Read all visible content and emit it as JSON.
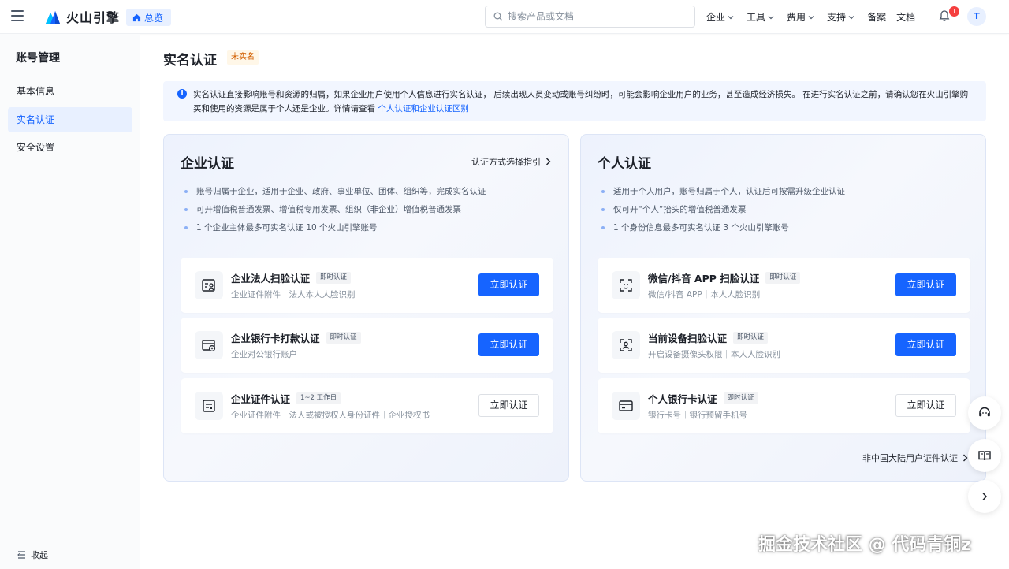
{
  "header": {
    "brand": "火山引擎",
    "overview_label": "总览",
    "search_placeholder": "搜索产品或文档",
    "nav": [
      {
        "label": "企业",
        "has_menu": true
      },
      {
        "label": "工具",
        "has_menu": true
      },
      {
        "label": "费用",
        "has_menu": true
      },
      {
        "label": "支持",
        "has_menu": true
      },
      {
        "label": "备案",
        "has_menu": false
      },
      {
        "label": "文档",
        "has_menu": false
      }
    ],
    "notification_count": "1",
    "avatar_initial": "T"
  },
  "sidebar": {
    "title": "账号管理",
    "items": [
      {
        "label": "基本信息",
        "active": false
      },
      {
        "label": "实名认证",
        "active": true
      },
      {
        "label": "安全设置",
        "active": false
      }
    ],
    "collapse_label": "收起"
  },
  "main": {
    "title": "实名认证",
    "status": "未实名",
    "notice": {
      "text": "实名认证直接影响账号和资源的归属，如果企业用户使用个人信息进行实名认证， 后续出现人员变动或账号纠纷时，可能会影响企业用户的业务，甚至造成经济损失。 在进行实名认证之前，请确认您在火山引擎购买和使用的资源是属于个人还是企业。详情请查看",
      "link": "个人认证和企业认证区别"
    },
    "enterprise": {
      "title": "企业认证",
      "guide_link": "认证方式选择指引",
      "bullets": [
        "账号归属于企业，适用于企业、政府、事业单位、团体、组织等，完成实名认证",
        "可开增值税普通发票、增值税专用发票、组织（非企业）增值税普通发票",
        "1 个企业主体最多可实名认证 10 个火山引擎账号"
      ],
      "methods": [
        {
          "title": "企业法人扫脸认证",
          "tag": "即时认证",
          "desc": "企业证件附件｜法人本人人脸识别",
          "button": "立即认证",
          "primary": true,
          "icon": "face-scan-id-icon"
        },
        {
          "title": "企业银行卡打款认证",
          "tag": "即时认证",
          "desc": "企业对公银行账户",
          "button": "立即认证",
          "primary": true,
          "icon": "bank-transfer-icon"
        },
        {
          "title": "企业证件认证",
          "tag": "1~2 工作日",
          "desc": "企业证件附件｜法人或被授权人身份证件｜企业授权书",
          "button": "立即认证",
          "primary": false,
          "icon": "certificate-icon"
        }
      ]
    },
    "personal": {
      "title": "个人认证",
      "bullets": [
        "适用于个人用户，账号归属于个人，认证后可按需升级企业认证",
        "仅可开“个人”抬头的增值税普通发票",
        "1 个身份信息最多可实名认证 3 个火山引擎账号"
      ],
      "methods": [
        {
          "title": "微信/抖音 APP 扫脸认证",
          "tag": "即时认证",
          "desc": "微信/抖音 APP｜本人人脸识别",
          "button": "立即认证",
          "primary": true,
          "icon": "scan-frame-icon"
        },
        {
          "title": "当前设备扫脸认证",
          "tag": "即时认证",
          "desc": "开启设备摄像头权限｜本人人脸识别",
          "button": "立即认证",
          "primary": true,
          "icon": "face-scan-icon"
        },
        {
          "title": "个人银行卡认证",
          "tag": "即时认证",
          "desc": "银行卡号｜银行预留手机号",
          "button": "立即认证",
          "primary": false,
          "icon": "bank-card-icon"
        }
      ],
      "foreign_link": "非中国大陆用户证件认证"
    }
  },
  "watermark": "掘金技术社区 @ 代码青铜z",
  "colors": {
    "primary": "#1664ff",
    "warning_text": "#d25f00",
    "warning_bg": "#fff7e8",
    "badge": "#f53f3f"
  }
}
